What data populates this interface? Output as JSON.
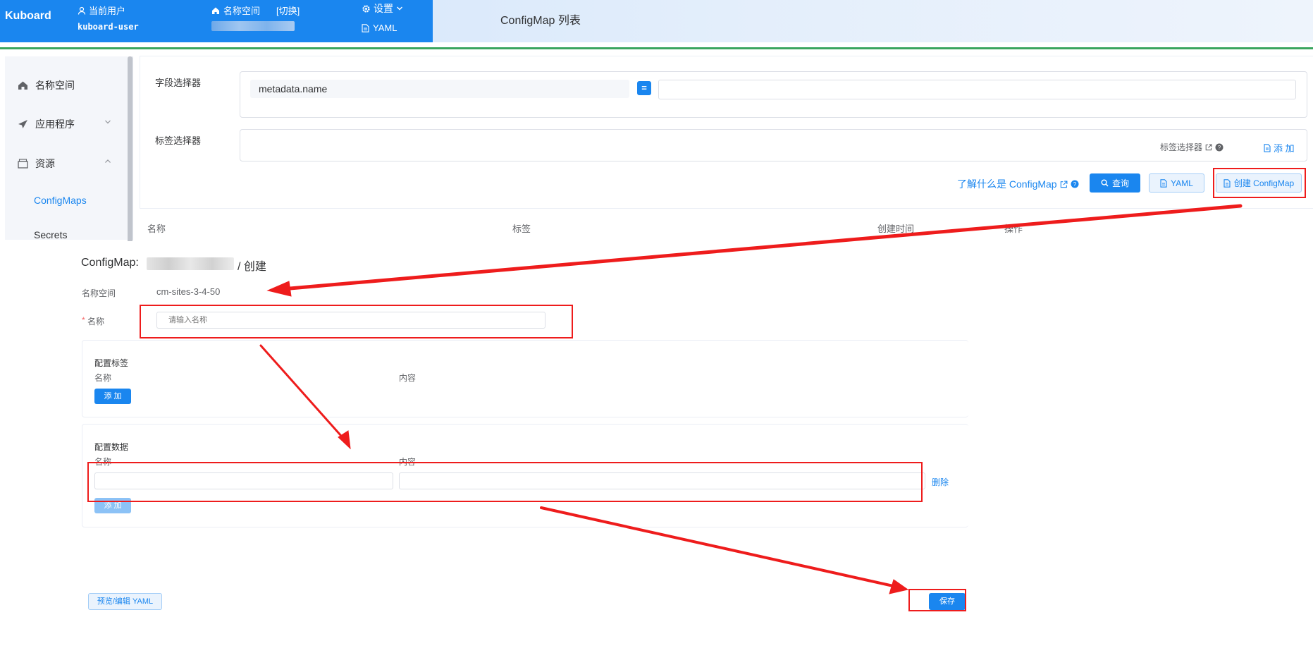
{
  "header": {
    "logo": "Kuboard",
    "current_user_label": "当前用户",
    "username": "kuboard-user",
    "namespace_label": "名称空间",
    "namespace_switch": "[切换]",
    "settings_label": "设置",
    "yaml_label": "YAML",
    "page_title": "ConfigMap 列表"
  },
  "sidebar": {
    "items": [
      {
        "label": "名称空间",
        "icon": "home-icon"
      },
      {
        "label": "应用程序",
        "icon": "paper-plane-icon",
        "chevron": "down"
      },
      {
        "label": "资源",
        "icon": "box-icon",
        "chevron": "up"
      }
    ],
    "sub_items": [
      {
        "label": "ConfigMaps",
        "active": true
      },
      {
        "label": "Secrets",
        "active": false
      }
    ]
  },
  "filters": {
    "field_selector_label": "字段选择器",
    "field_name": "metadata.name",
    "operator": "=",
    "field_value": "",
    "label_selector_label": "标签选择器",
    "label_selector_hint": "标签选择器",
    "add_label": "添 加",
    "learn_link": "了解什么是 ConfigMap",
    "query_button": "查询",
    "yaml_button": "YAML",
    "create_button": "创建 ConfigMap"
  },
  "table": {
    "columns": [
      "名称",
      "标签",
      "创建时间",
      "操作"
    ]
  },
  "create_form": {
    "title_prefix": "ConfigMap:",
    "title_suffix": "/ 创建",
    "namespace_label": "名称空间",
    "namespace_value": "cm-sites-3-4-50",
    "name_required_mark": "*",
    "name_label": "名称",
    "name_placeholder": "请输入名称",
    "labels_section": {
      "title": "配置标签",
      "name_col": "名称",
      "content_col": "内容",
      "add_button": "添 加"
    },
    "data_section": {
      "title": "配置数据",
      "name_col": "名称",
      "content_col": "内容",
      "name_value": "",
      "content_value": "",
      "delete_link": "删除",
      "add_button": "添 加"
    },
    "preview_yaml_button": "预览/编辑 YAML",
    "save_button": "保存"
  },
  "colors": {
    "brand": "#1a86ef",
    "annotation_red": "#ee1c1c",
    "divider_green": "#3aa55e"
  }
}
